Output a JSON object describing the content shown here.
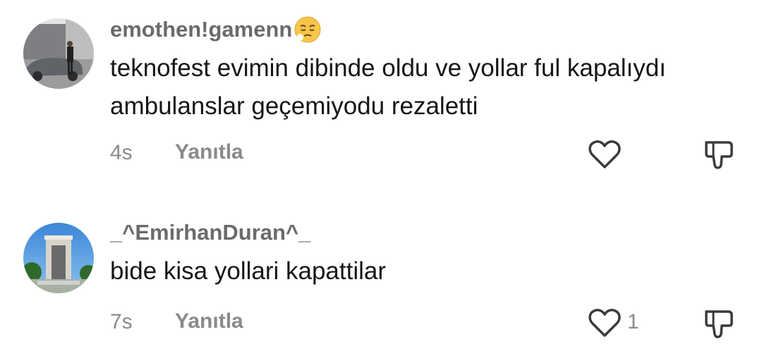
{
  "comments": [
    {
      "username": "emothen!gamenn",
      "emoji": "weary-face-emoji",
      "text_line1": "teknofest evimin dibinde oldu ve yollar ful kapalıydı",
      "text_line2": "ambulanslar geçemiyodu rezaletti",
      "time": "4s",
      "reply_label": "Yanıtla",
      "likes": ""
    },
    {
      "username": "_^EmirhanDuran^_",
      "text_line1": "bide kisa yollari kapattilar",
      "time": "7s",
      "reply_label": "Yanıtla",
      "likes": "1"
    }
  ],
  "colors": {
    "username": "#6b6b6b",
    "text": "#161616",
    "meta": "#8a8a8a",
    "icon": "#3a3a3a"
  }
}
